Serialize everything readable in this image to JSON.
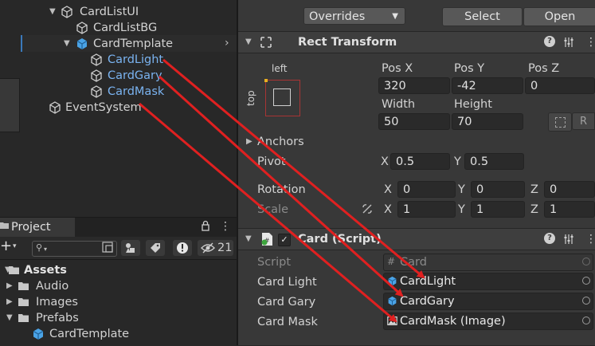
{
  "hierarchy": {
    "items": [
      {
        "label": "CardListUI",
        "selected": false
      },
      {
        "label": "CardListBG",
        "selected": false
      },
      {
        "label": "CardTemplate",
        "selected": true
      },
      {
        "label": "CardLight",
        "selected": false
      },
      {
        "label": "CardGary",
        "selected": false
      },
      {
        "label": "CardMask",
        "selected": false
      },
      {
        "label": "EventSystem",
        "selected": false
      }
    ]
  },
  "project": {
    "tab_label": "Project",
    "hidden_count": "21",
    "tree": [
      {
        "label": "Assets"
      },
      {
        "label": "Audio"
      },
      {
        "label": "Images"
      },
      {
        "label": "Prefabs"
      },
      {
        "label": "CardTemplate"
      }
    ]
  },
  "inspector": {
    "overrides_label": "Overrides",
    "select_label": "Select",
    "open_label": "Open",
    "rect_transform": {
      "title": "Rect Transform",
      "anchor_left_label": "left",
      "anchor_top_label": "top",
      "posx_label": "Pos X",
      "posx": "320",
      "posy_label": "Pos Y",
      "posy": "-42",
      "posz_label": "Pos Z",
      "posz": "0",
      "width_label": "Width",
      "width": "50",
      "height_label": "Height",
      "height": "70",
      "r_label": "R",
      "anchors_label": "Anchors",
      "pivot_label": "Pivot",
      "pivot_x_label": "X",
      "pivot_x": "0.5",
      "pivot_y_label": "Y",
      "pivot_y": "0.5",
      "rotation_label": "Rotation",
      "rot_x_label": "X",
      "rot_x": "0",
      "rot_y_label": "Y",
      "rot_y": "0",
      "rot_z_label": "Z",
      "rot_z": "0",
      "scale_label": "Scale",
      "scale_x_label": "X",
      "scale_x": "1",
      "scale_y_label": "Y",
      "scale_y": "1",
      "scale_z_label": "Z",
      "scale_z": "1"
    },
    "card_script": {
      "title": "Card (Script)",
      "script_label": "Script",
      "script_value": "Card",
      "fields": [
        {
          "label": "Card Light",
          "value": "CardLight",
          "icon": "cube-icon"
        },
        {
          "label": "Card Gary",
          "value": "CardGary",
          "icon": "cube-icon"
        },
        {
          "label": "Card Mask",
          "value": "CardMask (Image)",
          "icon": "image-icon"
        }
      ]
    }
  },
  "colors": {
    "arrow": "#e02020",
    "selection": "#3a79bb",
    "link_text": "#7ab3f0"
  }
}
